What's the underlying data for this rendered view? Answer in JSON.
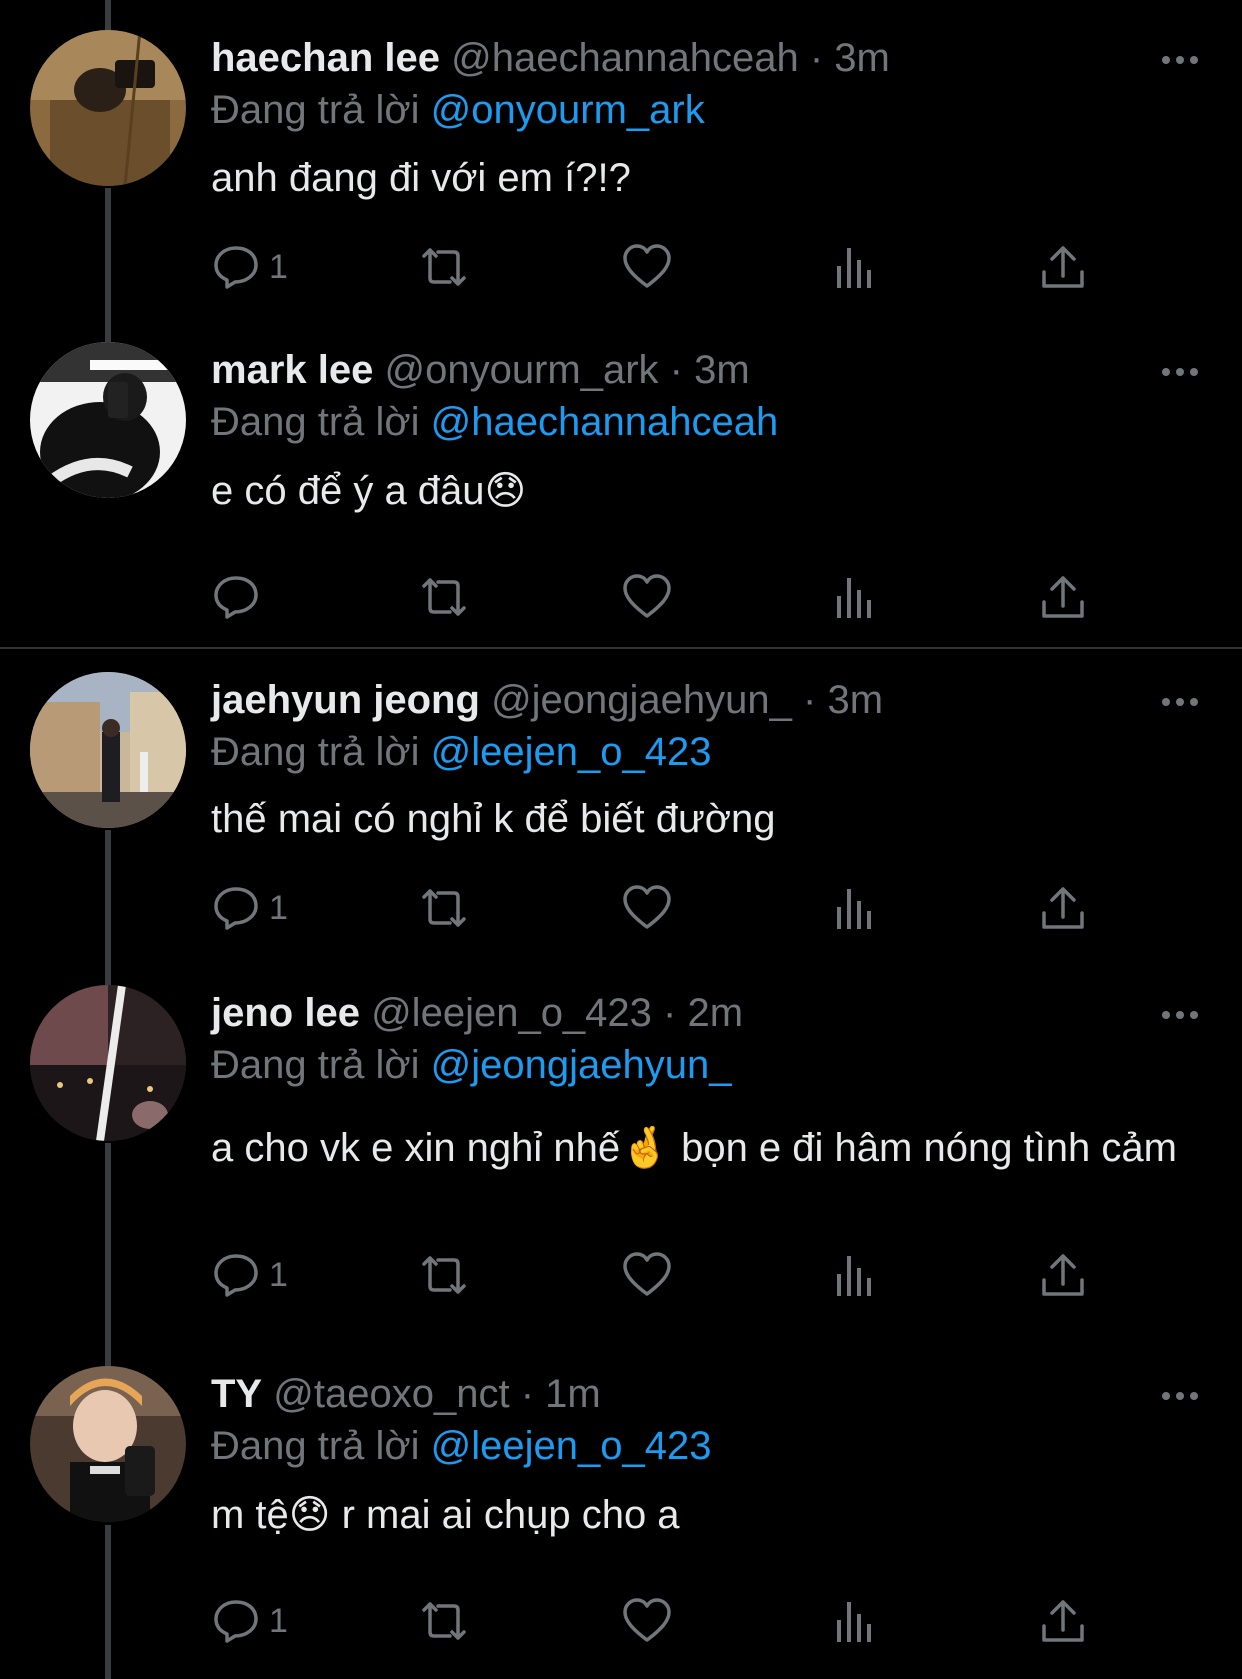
{
  "colors": {
    "background": "#000000",
    "text": "#e7e9ea",
    "muted": "#71767b",
    "accent": "#1d9bf0",
    "thread_line": "#3a3d40",
    "divider": "#2f3336"
  },
  "reply_prefix": "Đang trả lời",
  "tweets": [
    {
      "name": "haechan lee",
      "handle": "@haechannahceah",
      "sep": "·",
      "time": "3m",
      "reply_to": "@onyourm_ark",
      "text": "anh đang đi với em í?!?",
      "reply_count": "1",
      "icons": [
        "reply-icon",
        "retweet-icon",
        "like-icon",
        "views-icon",
        "share-icon",
        "more-icon"
      ]
    },
    {
      "name": "mark lee",
      "handle": "@onyourm_ark",
      "sep": "·",
      "time": "3m",
      "reply_to": "@haechannahceah",
      "text": "e có để ý a đâu😞",
      "reply_count": "",
      "icons": [
        "reply-icon",
        "retweet-icon",
        "like-icon",
        "views-icon",
        "share-icon",
        "more-icon"
      ]
    },
    {
      "name": "jaehyun jeong",
      "handle": "@jeongjaehyun_",
      "sep": "·",
      "time": "3m",
      "reply_to": "@leejen_o_423",
      "text": "thế mai có nghỉ k để biết đường",
      "reply_count": "1",
      "icons": [
        "reply-icon",
        "retweet-icon",
        "like-icon",
        "views-icon",
        "share-icon",
        "more-icon"
      ]
    },
    {
      "name": "jeno lee",
      "handle": "@leejen_o_423",
      "sep": "·",
      "time": "2m",
      "reply_to": "@jeongjaehyun_",
      "text": "a cho vk e xin nghỉ nhế🤞 bọn e đi hâm nóng tình cảm",
      "reply_count": "1",
      "icons": [
        "reply-icon",
        "retweet-icon",
        "like-icon",
        "views-icon",
        "share-icon",
        "more-icon"
      ]
    },
    {
      "name": "TY",
      "handle": "@taeoxo_nct",
      "sep": "·",
      "time": "1m",
      "reply_to": "@leejen_o_423",
      "text": "m tệ😞 r mai ai chụp cho a",
      "reply_count": "1",
      "icons": [
        "reply-icon",
        "retweet-icon",
        "like-icon",
        "views-icon",
        "share-icon",
        "more-icon"
      ]
    }
  ]
}
